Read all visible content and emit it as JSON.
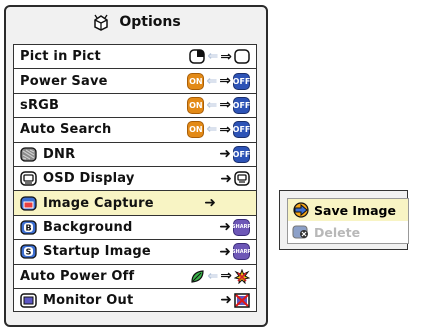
{
  "window": {
    "title": "Options",
    "title_icon": "options-menu-icon"
  },
  "rows": [
    {
      "label": "Pict in Pict",
      "icon": "",
      "control": "toggle-pip"
    },
    {
      "label": "Power Save",
      "icon": "",
      "control": "toggle-on-off",
      "left": "ON",
      "right": "OFF"
    },
    {
      "label": "sRGB",
      "icon": "",
      "control": "toggle-on-off",
      "left": "ON",
      "right": "OFF"
    },
    {
      "label": "Auto Search",
      "icon": "",
      "control": "toggle-on-off",
      "left": "ON",
      "right": "OFF"
    },
    {
      "label": "DNR",
      "icon": "dnr-icon",
      "control": "submenu",
      "right": "OFF"
    },
    {
      "label": "OSD Display",
      "icon": "osd-display-icon",
      "control": "submenu-osd"
    },
    {
      "label": "Image Capture",
      "icon": "image-capture-icon",
      "control": "submenu-arrow",
      "selected": true
    },
    {
      "label": "Background",
      "icon": "background-icon",
      "control": "submenu",
      "right": "SHARP"
    },
    {
      "label": "Startup Image",
      "icon": "startup-image-icon",
      "control": "submenu",
      "right": "SHARP"
    },
    {
      "label": "Auto Power Off",
      "icon": "",
      "control": "auto-power-off"
    },
    {
      "label": "Monitor Out",
      "icon": "monitor-out-icon",
      "control": "monitor-out"
    }
  ],
  "submenu": {
    "items": [
      {
        "label": "Save Image",
        "icon": "save-image-icon",
        "enabled": true
      },
      {
        "label": "Delete",
        "icon": "delete-icon",
        "enabled": false
      }
    ]
  },
  "badges": {
    "on": "ON",
    "off": "OFF",
    "sharp": "SHARP",
    "b": "B",
    "s": "S"
  },
  "colors": {
    "selected": "#f8f4c4",
    "on": "#e38a17",
    "off": "#2d53b6",
    "sharp": "#6d57b7",
    "panel": "#f1f1f1"
  }
}
